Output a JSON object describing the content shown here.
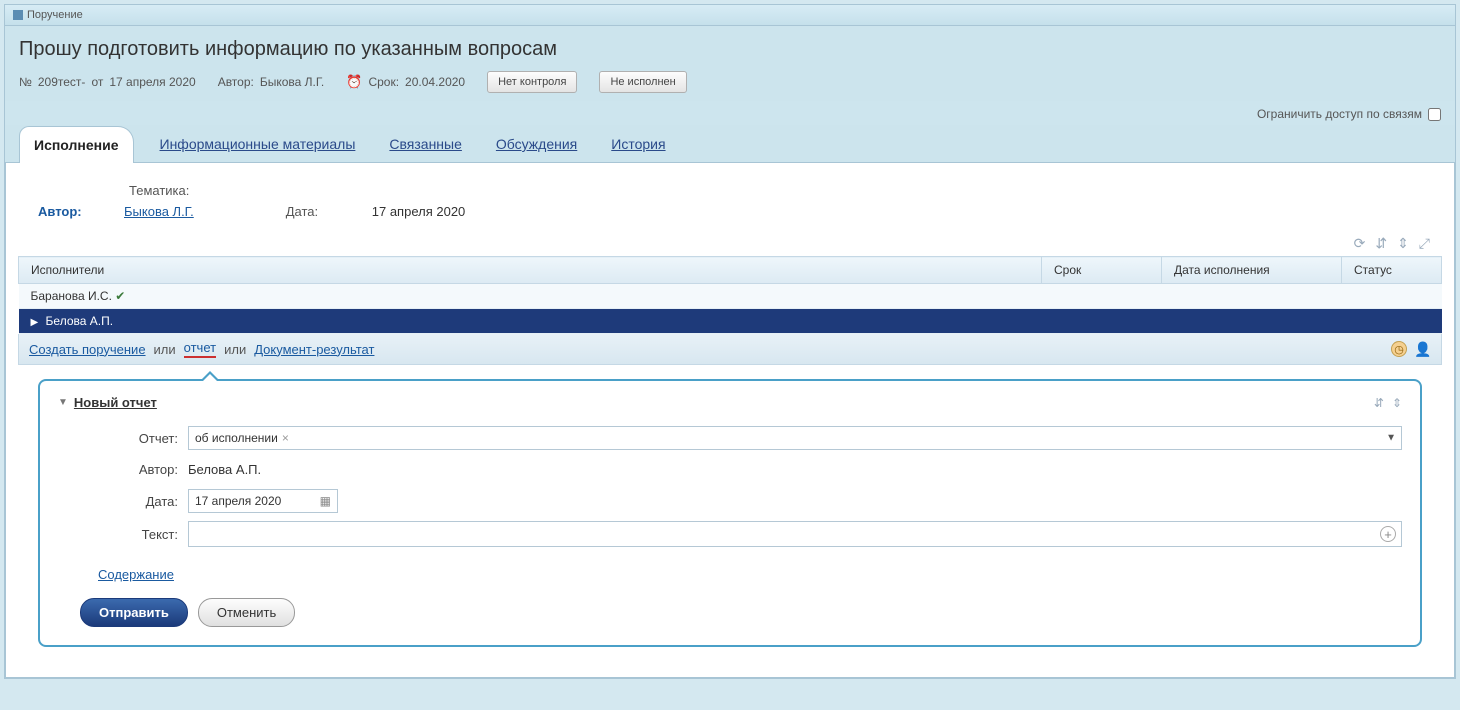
{
  "titlebar": {
    "label": "Поручение"
  },
  "header": {
    "title": "Прошу подготовить информацию по указанным вопросам",
    "number_prefix": "№",
    "number": "209тест-",
    "date_prefix": "от",
    "date": "17 апреля 2020",
    "author_label": "Автор:",
    "author": "Быкова Л.Г.",
    "deadline_label": "Срок:",
    "deadline": "20.04.2020",
    "status1": "Нет контроля",
    "status2": "Не исполнен",
    "restrict_label": "Ограничить доступ по связям"
  },
  "tabs": [
    "Исполнение",
    "Информационные материалы",
    "Связанные",
    "Обсуждения",
    "История"
  ],
  "info": {
    "topic_label": "Тематика:",
    "topic": "",
    "author_label": "Автор:",
    "author": "Быкова Л.Г.",
    "date_label": "Дата:",
    "date": "17 апреля 2020"
  },
  "exec_table": {
    "headers": {
      "executors": "Исполнители",
      "deadline": "Срок",
      "exec_date": "Дата исполнения",
      "status": "Статус"
    },
    "rows": [
      {
        "name": "Баранова И.С.",
        "checked": true,
        "selected": false
      },
      {
        "name": "Белова А.П.",
        "checked": false,
        "selected": true
      }
    ]
  },
  "actions": {
    "create": "Создать поручение",
    "or1": "или",
    "report": "отчет",
    "or2": "или",
    "doc": "Документ-результат"
  },
  "report_form": {
    "panel_title": "Новый отчет",
    "report_label": "Отчет:",
    "report_value": "об исполнении",
    "author_label": "Автор:",
    "author_value": "Белова А.П.",
    "date_label": "Дата:",
    "date_value": "17 апреля 2020",
    "text_label": "Текст:",
    "text_value": "",
    "content_link": "Содержание",
    "submit": "Отправить",
    "cancel": "Отменить"
  }
}
